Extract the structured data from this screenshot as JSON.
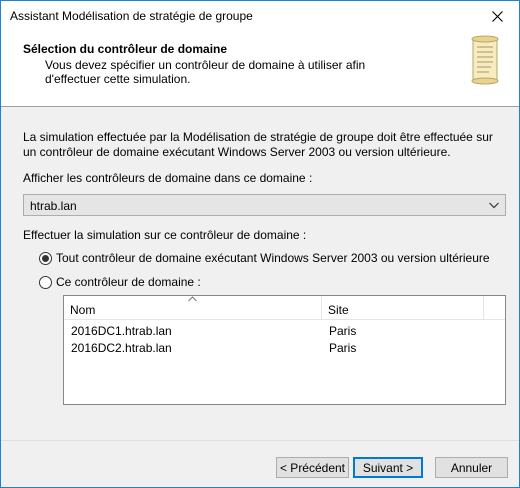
{
  "window": {
    "title": "Assistant Modélisation de stratégie de groupe"
  },
  "header": {
    "title": "Sélection du contrôleur de domaine",
    "subtitle": "Vous devez spécifier un contrôleur de domaine à utiliser afin d'effectuer cette simulation."
  },
  "body": {
    "description": "La simulation effectuée par la Modélisation de stratégie de groupe doit être effectuée sur un contrôleur de domaine exécutant Windows Server 2003 ou version ultérieure.",
    "show_dc_label": "Afficher les contrôleurs de domaine dans ce domaine :",
    "domain_combo_value": "htrab.lan",
    "run_on_label": "Effectuer la simulation sur ce contrôleur de domaine :",
    "radio_any": "Tout contrôleur de domaine exécutant Windows Server 2003 ou version ultérieure",
    "radio_this": "Ce contrôleur de domaine :",
    "selected_radio": "any"
  },
  "listview": {
    "columns": [
      "Nom",
      "Site"
    ],
    "rows": [
      {
        "name": "2016DC1.htrab.lan",
        "site": "Paris"
      },
      {
        "name": "2016DC2.htrab.lan",
        "site": "Paris"
      }
    ]
  },
  "footer": {
    "back_label": "< Précédent",
    "next_label": "Suivant >",
    "cancel_label": "Annuler"
  }
}
